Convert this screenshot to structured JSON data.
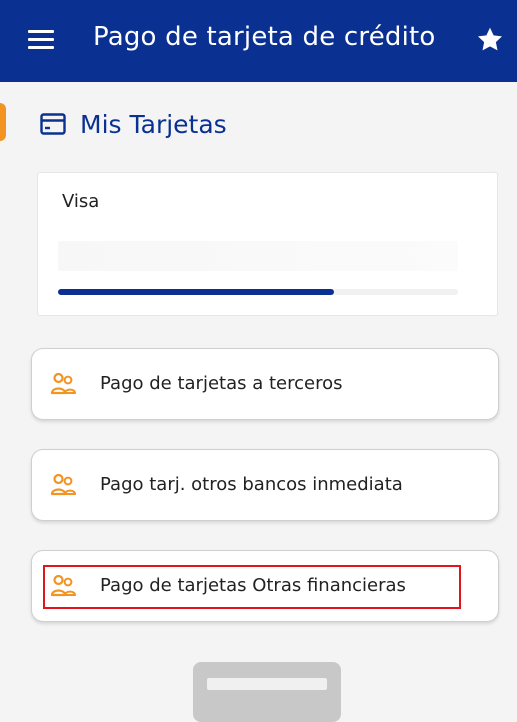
{
  "app_bar": {
    "title": "Pago de tarjeta de crédito",
    "menu_icon": "hamburger-menu-icon",
    "favorite_icon": "star-icon",
    "color": "#0a3191"
  },
  "section": {
    "title": "Mis Tarjetas",
    "icon": "credit-card-icon",
    "marker_color": "#f39322"
  },
  "card": {
    "name": "Visa",
    "progress_fraction": 0.69
  },
  "actions": [
    {
      "label": "Pago de tarjetas a terceros",
      "icon": "people-icon"
    },
    {
      "label": "Pago tarj. otros bancos inmediata",
      "icon": "people-icon"
    },
    {
      "label": "Pago de tarjetas Otras financieras",
      "icon": "people-icon",
      "highlighted": true
    }
  ],
  "colors": {
    "primary": "#0a3191",
    "accent": "#f39322",
    "highlight": "#e3151c"
  }
}
